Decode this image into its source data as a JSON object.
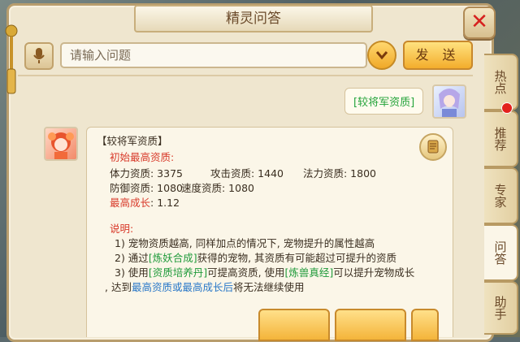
{
  "window": {
    "title": "精灵问答",
    "close_icon": "close-icon",
    "accent_color": "#f3ad2c",
    "red_color": "#e3211c"
  },
  "search": {
    "placeholder": "请输入问题",
    "send_label": "发 送",
    "mic_icon": "microphone-icon",
    "dropdown_icon": "chevron-down-icon"
  },
  "chat": {
    "user_question": "[较将军资质]",
    "answer": {
      "heading": "【较将军资质】",
      "initial_label": "初始最高资质:",
      "stats_row1": {
        "hp": "体力资质: 3375",
        "atk": "攻击资质: 1440",
        "mp": "法力资质: 1800"
      },
      "stats_row2": {
        "def": "防御资质: 1080",
        "spd": "速度资质: 1080"
      },
      "growth_label": "最高成长",
      "growth_value": ": 1.12",
      "notes_label": "说明:",
      "note1": "1) 宠物资质越高, 同样加点的情况下, 宠物提升的属性越高",
      "note2_a": "2) 通过",
      "note2_link": "[炼妖合成]",
      "note2_b": "获得的宠物, 其资质有可能超过可提升的资质",
      "note3_a": "3) 使用",
      "note3_link1": "[资质培养丹]",
      "note3_b": "可提高资质, 使用",
      "note3_link2": "[炼兽真经]",
      "note3_c": "可以提升宠物成长",
      "note4_a": ", 达到",
      "note4_blue": "最高资质或最高成长后",
      "note4_b": "将无法继续使用"
    }
  },
  "side_tabs": [
    {
      "label": "热点"
    },
    {
      "label": "推荐"
    },
    {
      "label": "专家"
    },
    {
      "label": "问答"
    },
    {
      "label": "助手"
    }
  ]
}
